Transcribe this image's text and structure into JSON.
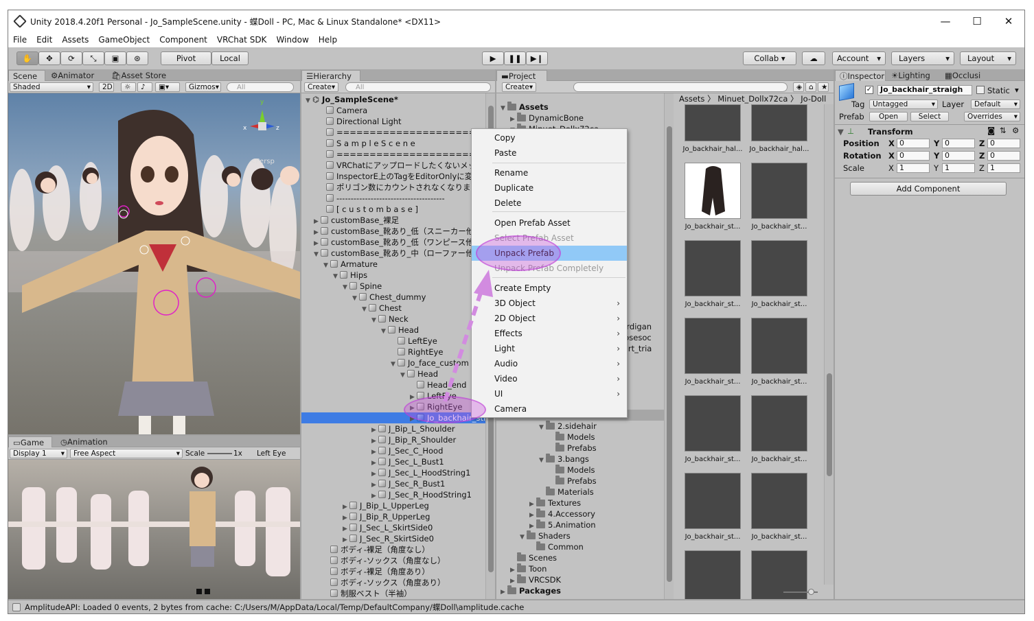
{
  "window": {
    "title": "Unity 2018.4.20f1 Personal - Jo_SampleScene.unity - 蝶Doll - PC, Mac & Linux Standalone* <DX11>",
    "minimize": "—",
    "maximize": "☐",
    "close": "✕"
  },
  "menu": [
    "File",
    "Edit",
    "Assets",
    "GameObject",
    "Component",
    "VRChat SDK",
    "Window",
    "Help"
  ],
  "toolbar": {
    "pivot": "Pivot",
    "local": "Local",
    "collab": "Collab ▾",
    "account": "Account",
    "layers": "Layers",
    "layout": "Layout"
  },
  "scene": {
    "tabs": [
      "Scene",
      "Animator",
      "Asset Store"
    ],
    "shading": "Shaded",
    "mode2d": "2D",
    "gizmos": "Gizmos",
    "search_placeholder": "All",
    "persp": "<Persp",
    "axis_x": "x",
    "axis_y": "y",
    "axis_z": "z"
  },
  "game": {
    "tabs": [
      "Game",
      "Animation"
    ],
    "display": "Display 1",
    "aspect": "Free Aspect",
    "scale_label": "Scale",
    "scale_value": "1x",
    "eye": "Left Eye"
  },
  "hierarchy": {
    "tab": "Hierarchy",
    "create": "Create",
    "search_placeholder": "All",
    "scene_name": "Jo_SampleScene*",
    "rows": [
      "Camera",
      "Directional Light",
      "============================",
      "S a m p l e   S c e n e",
      "============================",
      "VRChatにアップロードしたくないメッシュは",
      "InspectorE上のTagをEditorOnlyに変更してく",
      "ポリゴン数にカウントされなくなります",
      "--------------------------------------",
      "[ c u s t o m   b a s e ]",
      "customBase_裸足",
      "customBase_靴あり_低（スニーカー他",
      "customBase_靴あり_低（ワンピース他",
      "customBase_靴あり_中（ローファー他",
      "Armature",
      "Hips",
      "Spine",
      "Chest_dummy",
      "Chest",
      "Neck",
      "Head",
      "LeftEye",
      "RightEye",
      "Jo_face_custom",
      "Head",
      "Head_end",
      "LeftEye",
      "RightEye",
      "Jo_backhair_straight",
      "J_Bip_L_Shoulder",
      "J_Bip_R_Shoulder",
      "J_Sec_C_Hood",
      "J_Sec_L_Bust1",
      "J_Sec_L_HoodString1",
      "J_Sec_R_Bust1",
      "J_Sec_R_HoodString1",
      "J_Bip_L_UpperLeg",
      "J_Bip_R_UpperLeg",
      "J_Sec_L_SkirtSide0",
      "J_Sec_R_SkirtSide0",
      "ボディ-裸足（角度なし）",
      "ボディ-ソックス（角度なし）",
      "ボディ-裸足（角度あり）",
      "ボディ-ソックス（角度あり）",
      "制服ベスト（半袖）"
    ]
  },
  "project": {
    "tab": "Project",
    "create": "Create",
    "breadcrumb": [
      "Assets",
      "Minuet_Dollx72ca",
      "Jo-Doll"
    ],
    "tree_top": [
      "Assets",
      "DynamicBone",
      "Minuet_Dollx72ca"
    ],
    "tree_bottom": [
      "2.sidehair",
      "Models",
      "Prefabs",
      "3.bangs",
      "Models",
      "Prefabs",
      "Materials",
      "Textures",
      "4.Accessory",
      "5.Animation",
      "Shaders",
      "Common",
      "Scenes",
      "Toon",
      "VRCSDK",
      "Packages"
    ],
    "partial_names": [
      "cardigan",
      "loosesoc",
      "skirt_tria"
    ],
    "thumbs": [
      "Jo_backhair_hal...",
      "Jo_backhair_hal...",
      "Jo_backhair_st...",
      "Jo_backhair_st...",
      "Jo_backhair_st...",
      "Jo_backhair_st...",
      "Jo_backhair_st...",
      "Jo_backhair_st...",
      "Jo_backhair_st...",
      "Jo_backhair_st...",
      "Jo_backhair_st...",
      "Jo_backhair_st...",
      "",
      ""
    ]
  },
  "context_menu": {
    "items": [
      {
        "label": "Copy"
      },
      {
        "label": "Paste"
      },
      {
        "label": "Rename"
      },
      {
        "label": "Duplicate"
      },
      {
        "label": "Delete"
      },
      {
        "label": "Open Prefab Asset"
      },
      {
        "label": "Select Prefab Asset"
      },
      {
        "label": "Unpack Prefab"
      },
      {
        "label": "Unpack Prefab Completely"
      },
      {
        "label": "Create Empty"
      },
      {
        "label": "3D Object"
      },
      {
        "label": "2D Object"
      },
      {
        "label": "Effects"
      },
      {
        "label": "Light"
      },
      {
        "label": "Audio"
      },
      {
        "label": "Video"
      },
      {
        "label": "UI"
      },
      {
        "label": "Camera"
      }
    ],
    "submenu_arrow": "›"
  },
  "inspector": {
    "tabs": [
      "Inspector",
      "Lighting",
      "Occlusi"
    ],
    "object_name": "Jo_backhair_straigh",
    "static": "Static",
    "tag_label": "Tag",
    "tag_value": "Untagged",
    "layer_label": "Layer",
    "layer_value": "Default",
    "prefab_label": "Prefab",
    "open": "Open",
    "select": "Select",
    "overrides": "Overrides",
    "transform": "Transform",
    "position": "Position",
    "rotation": "Rotation",
    "scale": "Scale",
    "pos": [
      "0",
      "0",
      "0"
    ],
    "rot": [
      "0",
      "0",
      "0"
    ],
    "scl": [
      "1",
      "1",
      "1"
    ],
    "axis": [
      "X",
      "Y",
      "Z"
    ],
    "add_component": "Add Component"
  },
  "status": {
    "text": "AmplitudeAPI: Loaded 0 events, 2 bytes from cache: C:/Users/M/AppData/Local/Temp/DefaultCompany/蝶Doll\\amplitude.cache"
  }
}
